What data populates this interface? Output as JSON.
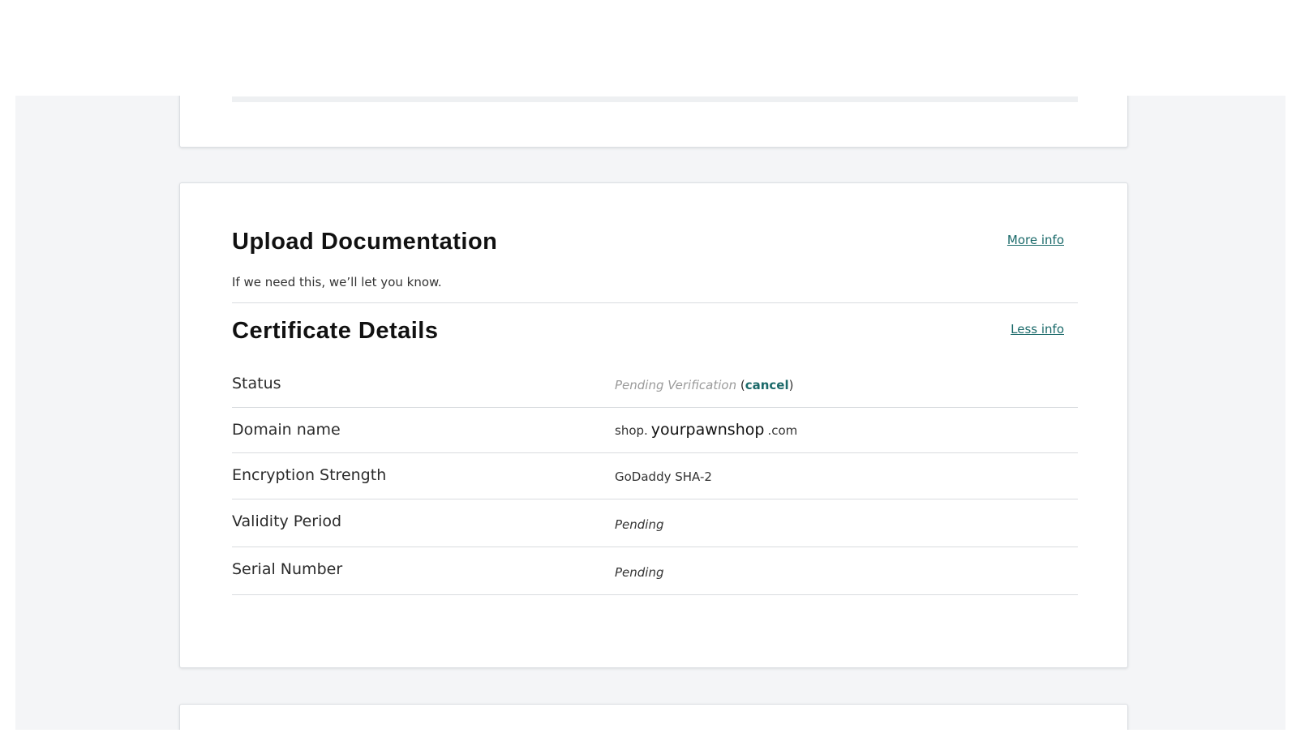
{
  "upload": {
    "title": "Upload Documentation",
    "more_info": "More info",
    "description": "If we need this, we’ll let you know."
  },
  "details": {
    "title": "Certificate Details",
    "less_info": "Less info",
    "status": {
      "label": "Status",
      "value": "Pending Verification",
      "open_paren": "(",
      "cancel": "cancel",
      "close_paren": ")"
    },
    "domain": {
      "label": "Domain name",
      "prefix": "shop.",
      "name": "yourpawnshop",
      "suffix": ".com"
    },
    "encryption": {
      "label": "Encryption Strength",
      "value": "GoDaddy SHA-2"
    },
    "validity": {
      "label": "Validity Period",
      "value": "Pending"
    },
    "serial": {
      "label": "Serial Number",
      "value": "Pending"
    }
  },
  "colors": {
    "link": "#1b6a6a",
    "page_bg": "#f4f5f7",
    "card_bg": "#ffffff"
  }
}
